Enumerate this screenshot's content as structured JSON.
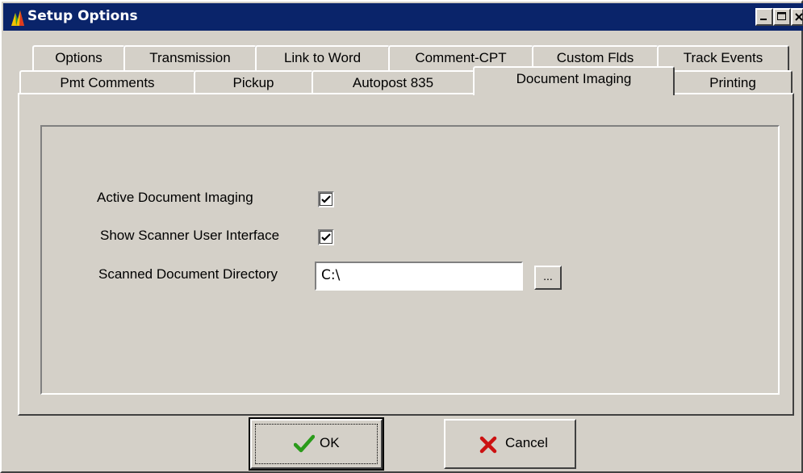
{
  "window": {
    "title": "Setup Options"
  },
  "tabs": {
    "row1": [
      "Options",
      "Transmission",
      "Link to Word",
      "Comment-CPT",
      "Custom Flds",
      "Track Events"
    ],
    "row2": [
      "Pmt Comments",
      "Pickup",
      "Autopost 835",
      "Document Imaging",
      "Printing"
    ],
    "active": "Document Imaging"
  },
  "form": {
    "active_imaging_label": "Active Document Imaging",
    "active_imaging_checked": true,
    "show_scanner_label": "Show Scanner User Interface",
    "show_scanner_checked": true,
    "directory_label": "Scanned Document Directory",
    "directory_value": "C:\\",
    "browse_label": "..."
  },
  "buttons": {
    "ok_label": "OK",
    "cancel_label": "Cancel"
  },
  "colors": {
    "titlebar": "#0a246a",
    "face": "#d4d0c8",
    "ok_check": "#2a9b1a",
    "cancel_x": "#cc1111"
  },
  "icons": {
    "app": "app-logo-icon",
    "ok": "green-checkmark-icon",
    "cancel": "red-x-icon"
  }
}
